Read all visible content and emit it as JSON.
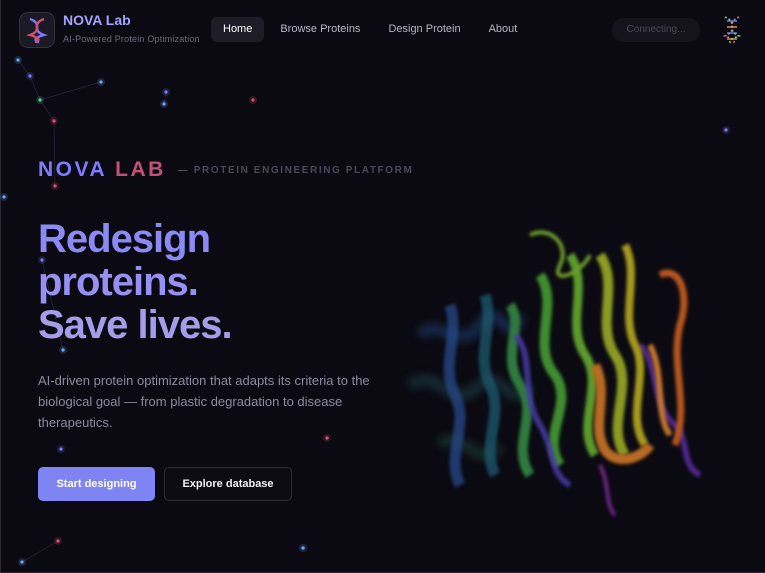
{
  "header": {
    "brand": {
      "name": "NOVA Lab",
      "tagline": "AI-Powered Protein Optimization"
    },
    "nav": [
      {
        "label": "Home",
        "active": true
      },
      {
        "label": "Browse Proteins",
        "active": false
      },
      {
        "label": "Design Protein",
        "active": false
      },
      {
        "label": "About",
        "active": false
      }
    ],
    "status": "Connecting...",
    "helix_icon": "dna-helix-icon"
  },
  "hero": {
    "eyebrow": {
      "nova": "NOVA",
      "lab": "LAB",
      "tag": "— PROTEIN ENGINEERING PLATFORM"
    },
    "headline": [
      "Redesign",
      "proteins.",
      "Save lives."
    ],
    "lead": "AI-driven protein optimization that adapts its criteria to the biological goal — from plastic degradation to disease therapeutics.",
    "primary_cta": "Start designing",
    "secondary_cta": "Explore database"
  },
  "colors": {
    "background": "#0b0a12",
    "accent": "#7f84f3",
    "brand_nova": "#7f7bff",
    "brand_lab": "#c25275"
  }
}
